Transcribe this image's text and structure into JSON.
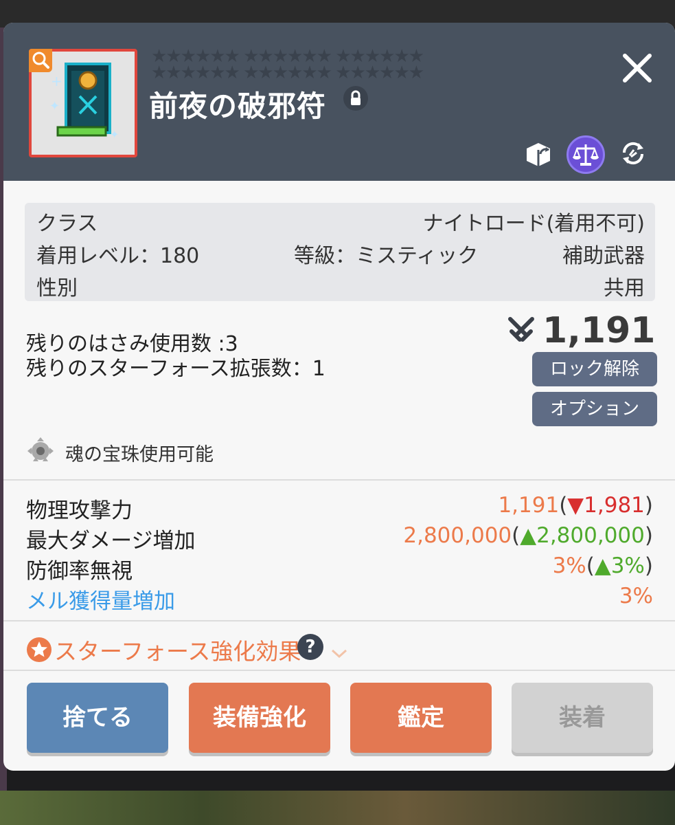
{
  "item": {
    "name": "前夜の破邪符",
    "stars": "★★★★★★ ★★★★★★ ★★★★★★ ★★★★★★ ★★★★★★ ★★★★★★"
  },
  "header_icons": [
    "trade-box-icon",
    "balance-scale-icon",
    "refresh-icon"
  ],
  "info": {
    "class_label": "クラス",
    "class_value": "ナイトロード(着用不可)",
    "level_text": "着用レベル：180",
    "grade_text": "等級：ミスティック",
    "type_text": "補助武器",
    "gender_label": "性別",
    "gender_value": "共用"
  },
  "upgrades": {
    "scissors_text": "残りのはさみ使用数 :3",
    "starforce_text": "残りのスターフォース拡張数：1"
  },
  "combat_power": "1,191",
  "buttons": {
    "unlock": "ロック解除",
    "option": "オプション"
  },
  "soul": {
    "text": "魂の宝珠使用可能"
  },
  "stats": [
    {
      "label": "物理攻撃力",
      "value": "1,191",
      "open": "(",
      "arrow": "▼",
      "delta": "1,981",
      "close": ")",
      "direction": "down",
      "label_color": "default"
    },
    {
      "label": "最大ダメージ増加",
      "value": "2,800,000",
      "open": "(",
      "arrow": "▲",
      "delta": "2,800,000",
      "close": ")",
      "direction": "up",
      "label_color": "default"
    },
    {
      "label": "防御率無視",
      "value": "3%",
      "open": "(",
      "arrow": "▲",
      "delta": "3%",
      "close": ")",
      "direction": "up",
      "label_color": "default"
    },
    {
      "label": "メル獲得量増加",
      "value": "3%",
      "open": "",
      "arrow": "",
      "delta": "",
      "close": "",
      "direction": "none",
      "label_color": "#3a9be8"
    }
  ],
  "starforce_effect": {
    "label": "スターフォース強化効果",
    "help": "?"
  },
  "actions": {
    "discard": "捨てる",
    "enhance": "装備強化",
    "appraise": "鑑定",
    "equip": "装着"
  },
  "colors": {
    "header_bg": "#48525f",
    "accent_orange": "#e37852",
    "accent_blue": "#5c87b5",
    "stat_down": "#d82e2e",
    "stat_up": "#4faa2c"
  }
}
